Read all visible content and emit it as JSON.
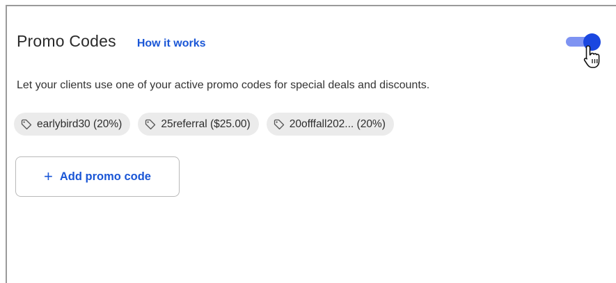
{
  "promo": {
    "title": "Promo Codes",
    "how_it_works": "How it works",
    "toggle_enabled": true,
    "description": "Let your clients use one of your active promo codes for special deals and discounts.",
    "codes": [
      {
        "label": "earlybird30 (20%)",
        "icon": "tag-icon"
      },
      {
        "label": "25referral ($25.00)",
        "icon": "tag-icon"
      },
      {
        "label": "20offfall202... (20%)",
        "icon": "tag-icon"
      }
    ],
    "add_button": {
      "icon": "plus-icon",
      "label": "Add promo code"
    }
  },
  "colors": {
    "accent": "#1a56d6",
    "toggle_knob": "#1a47e0",
    "toggle_track": "#7e93f2",
    "chip_bg": "#ebebeb"
  }
}
